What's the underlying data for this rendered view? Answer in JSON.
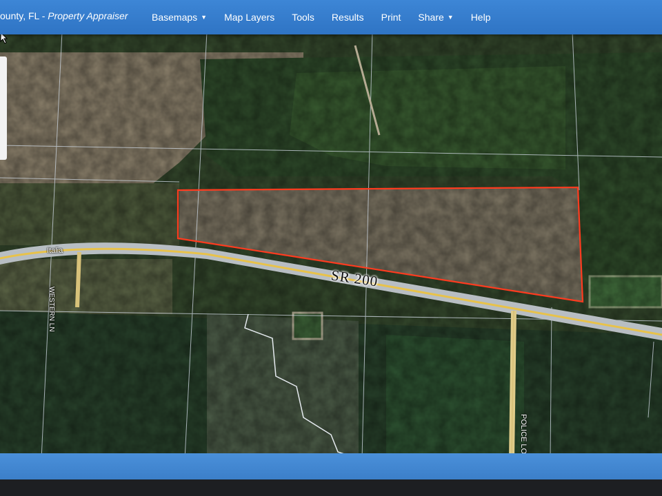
{
  "header": {
    "title_prefix": "ounty, FL - ",
    "title_main": "Property Appraiser",
    "nav": [
      {
        "label": "Basemaps",
        "dropdown": true
      },
      {
        "label": "Map Layers",
        "dropdown": false
      },
      {
        "label": "Tools",
        "dropdown": false
      },
      {
        "label": "Results",
        "dropdown": false
      },
      {
        "label": "Print",
        "dropdown": false
      },
      {
        "label": "Share",
        "dropdown": true
      },
      {
        "label": "Help",
        "dropdown": false
      }
    ]
  },
  "map": {
    "road_labels": {
      "highway": "SR 200",
      "italia": "Italia",
      "western": "WESTERN LN",
      "police": "POLICE LODGE"
    },
    "selection_color": "#ff3b1f",
    "road_color": "#e8c24a"
  },
  "icons": {
    "caret": "chevron-down-icon",
    "pointer": "mouse-pointer-icon"
  }
}
